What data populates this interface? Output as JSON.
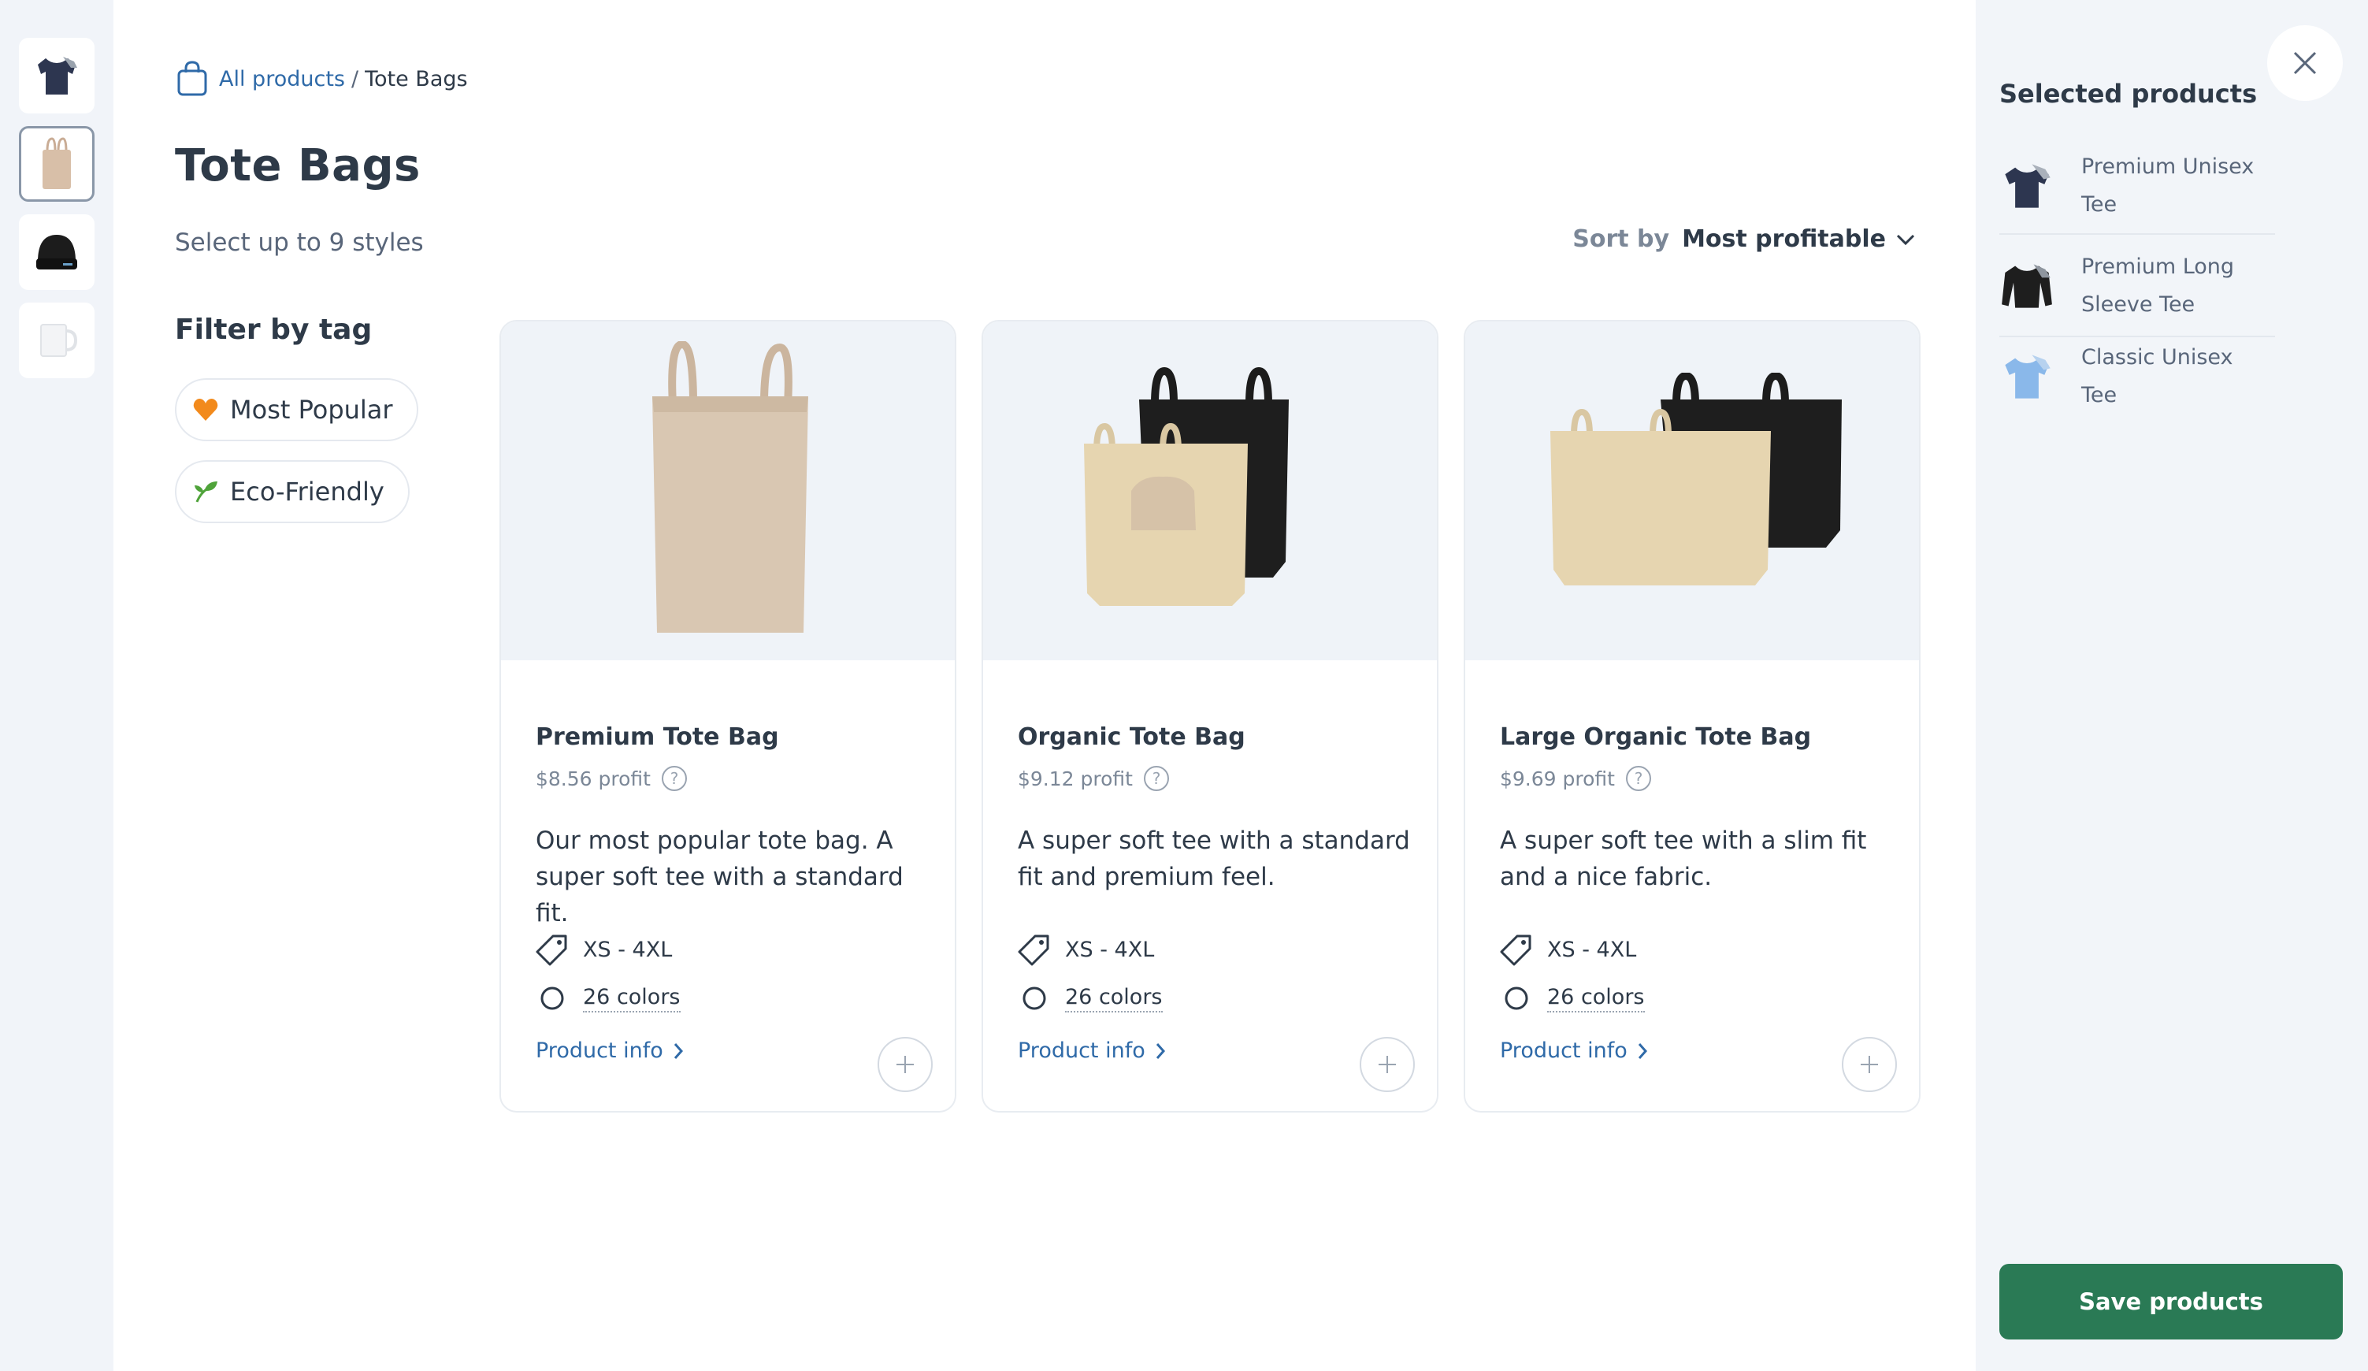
{
  "breadcrumb": {
    "root_label": "All products",
    "separator": "/",
    "current_label": "Tote Bags"
  },
  "page": {
    "title": "Tote Bags",
    "subtitle": "Select up to 9 styles"
  },
  "sort": {
    "label": "Sort by",
    "value": "Most profitable"
  },
  "filters": {
    "title": "Filter by tag",
    "tags": [
      {
        "label": "Most Popular",
        "icon": "heart-icon",
        "color": "#f28a1c"
      },
      {
        "label": "Eco-Friendly",
        "icon": "sprout-icon",
        "color": "#4fa33a"
      }
    ]
  },
  "rail": {
    "items": [
      {
        "icon": "tshirt-icon",
        "active": false
      },
      {
        "icon": "tote-bag-icon",
        "active": true
      },
      {
        "icon": "beanie-icon",
        "active": false
      },
      {
        "icon": "mug-icon",
        "active": false
      }
    ]
  },
  "products": [
    {
      "name": "Premium Tote Bag",
      "profit": "$8.56 profit",
      "description": "Our most popular tote bag. A super soft tee with a standard fit.",
      "sizes": "XS - 4XL",
      "colors": "26 colors",
      "info_label": "Product info"
    },
    {
      "name": "Organic Tote Bag",
      "profit": "$9.12 profit",
      "description": "A super soft tee with a standard fit and premium feel.",
      "sizes": "XS - 4XL",
      "colors": "26 colors",
      "info_label": "Product info"
    },
    {
      "name": "Large Organic Tote Bag",
      "profit": "$9.69 profit",
      "description": "A super soft tee with a slim fit and a nice fabric.",
      "sizes": "XS - 4XL",
      "colors": "26 colors",
      "info_label": "Product info"
    }
  ],
  "selected": {
    "title": "Selected products",
    "items": [
      {
        "name": "Premium Unisex Tee",
        "color": "#2d3650"
      },
      {
        "name": "Premium Long Sleeve Tee",
        "color": "#1e1e1e"
      },
      {
        "name": "Classic Unisex Tee",
        "color": "#8ab8ea"
      }
    ]
  },
  "actions": {
    "save_label": "Save products"
  },
  "colors": {
    "accent_link": "#2f6aa8",
    "save_button": "#2a7a55",
    "panel_bg": "#f2f5f9"
  }
}
